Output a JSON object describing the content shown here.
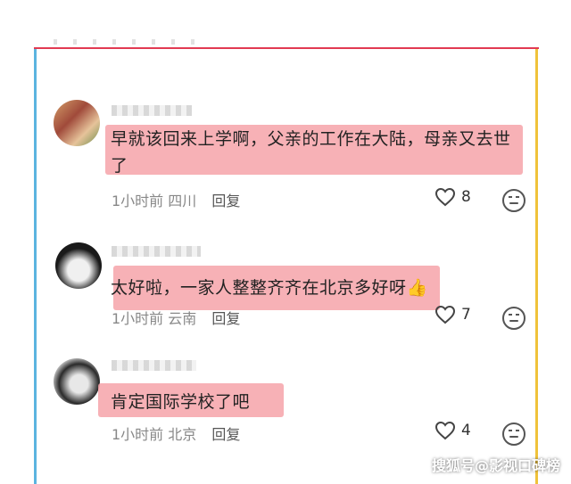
{
  "comments": [
    {
      "text_line1": "早就该回来上学啊，父亲的工作在大陆，母亲又去世",
      "text_line2": "了",
      "time": "1小时前",
      "location": "四川",
      "reply": "回复",
      "likes": "8"
    },
    {
      "text_line1": "太好啦，一家人整整齐齐在北京多好呀",
      "emoji": "👍",
      "time": "1小时前",
      "location": "云南",
      "reply": "回复",
      "likes": "7"
    },
    {
      "text_line1": "肯定国际学校了吧",
      "time": "1小时前",
      "location": "北京",
      "reply": "回复",
      "likes": "4"
    }
  ],
  "watermark": "搜狐号@影视口碑榜",
  "colors": {
    "highlight": "#f6a3a9",
    "frame_top": "#e23a52",
    "frame_left": "#5bb4e0",
    "frame_right": "#f0c23a"
  },
  "icons": [
    "heart-icon",
    "emoji-icon"
  ]
}
